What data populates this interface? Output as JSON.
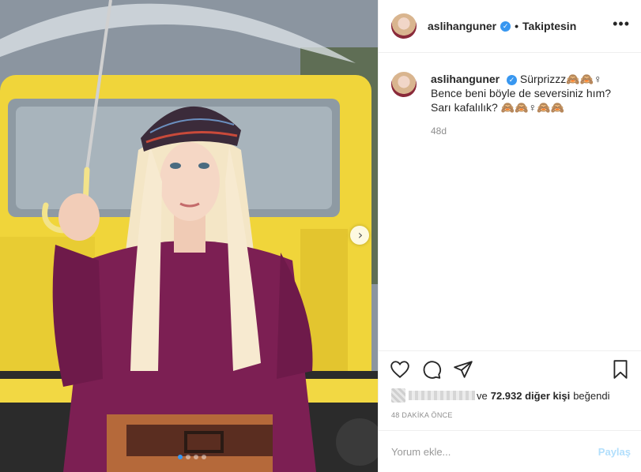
{
  "post": {
    "author": "aslihanguner",
    "follow_status": "Takiptesin",
    "separator": "•",
    "more_glyph": "•••",
    "caption_lines": [
      "Sürprizzz🙈🙈♀",
      "Bence beni böyle de seversiniz hım?",
      "Sarı kafalılık? 🙈🙈♀🙈🙈"
    ],
    "age": "48d",
    "likes_connector": "ve",
    "likes_count": "72.932 diğer kişi",
    "likes_suffix": "beğendi",
    "timestamp": "48 DAKİKA ÖNCE",
    "comment_placeholder": "Yorum ekle...",
    "share_label": "Paylaş"
  },
  "carousel": {
    "slides": 4,
    "active_index": 0,
    "next_glyph": "›"
  },
  "colors": {
    "accent": "#3897f0",
    "text": "#262626",
    "muted": "#8e8e8e",
    "divider": "#efefef",
    "share_disabled": "#b2dffc"
  },
  "icons": [
    "heart-icon",
    "comment-icon",
    "share-icon",
    "bookmark-icon",
    "verified-icon",
    "more-options-icon",
    "next-arrow-icon"
  ]
}
